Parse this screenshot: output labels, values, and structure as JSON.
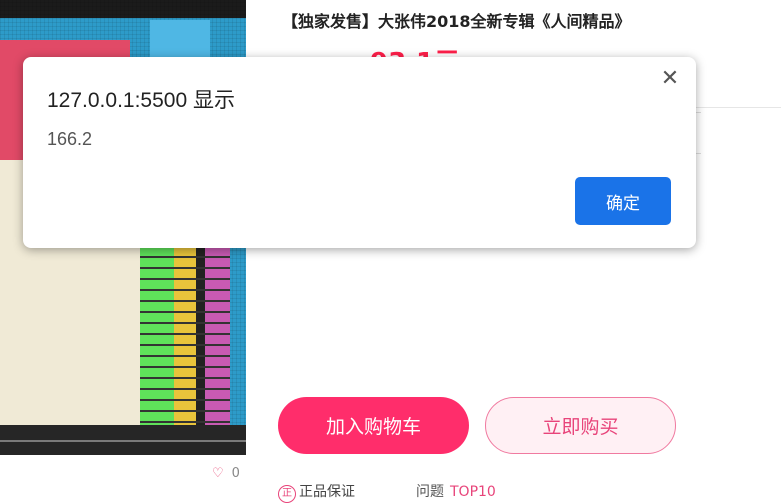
{
  "product": {
    "title": "【独家发售】大张伟2018全新专辑《人间精品》",
    "price": "93.1元",
    "like_count": "0",
    "add_to_cart_label": "加入购物车",
    "buy_now_label": "立即购买",
    "guarantee_badge": "正",
    "guarantee_label": "正品保证",
    "faq_label": "问题",
    "faq_top": "TOP10"
  },
  "alert": {
    "origin": "127.0.0.1:5500 显示",
    "message": "166.2",
    "close_glyph": "✕",
    "ok_label": "确定"
  },
  "colors": {
    "accent_pink": "#ff2d6b",
    "dialog_button_blue": "#1a73e8"
  },
  "icons": [
    "heart-icon",
    "close-icon",
    "genuine-badge-icon"
  ]
}
